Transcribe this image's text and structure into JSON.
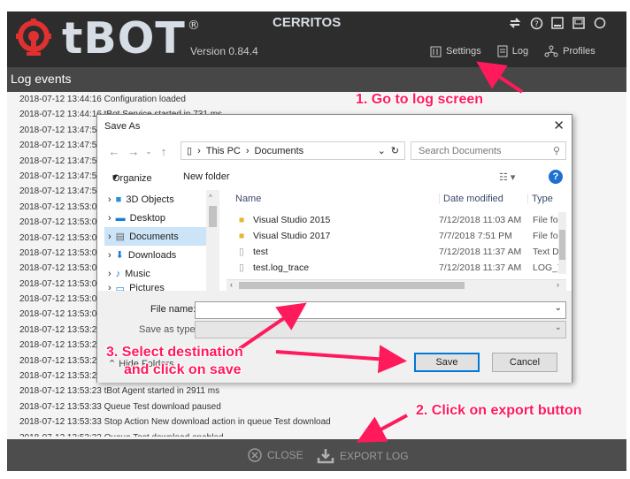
{
  "header": {
    "brand": "tBOT",
    "trademark": "®",
    "version": "Version 0.84.4",
    "device_name": "CERRITOS",
    "nav": {
      "settings": "Settings",
      "log": "Log",
      "profiles": "Profiles"
    }
  },
  "subheader": {
    "title": "Log events"
  },
  "log_lines": [
    "2018-07-12 13:44:16 Configuration loaded",
    "2018-07-12 13:44:16 tBot Service started in 731 ms",
    "2018-07-12 13:47:59",
    "2018-07-12 13:47:54",
    "2018-07-12 13:47:54",
    "2018-07-12 13:47:59",
    "2018-07-12 13:47:59",
    "2018-07-12 13:53:08",
    "2018-07-12 13:53:08",
    "2018-07-12 13:53:08",
    "2018-07-12 13:53:08",
    "2018-07-12 13:53:08",
    "2018-07-12 13:53:08",
    "2018-07-12 13:53:08",
    "2018-07-12 13:53:08",
    "2018-07-12 13:53:20",
    "2018-07-12 13:53:21",
    "2018-07-12 13:53:22",
    "2018-07-12 13:53:22",
    "2018-07-12 13:53:23 tBot Agent started in 2911 ms",
    "2018-07-12 13:53:33 Queue Test download paused",
    "2018-07-12 13:53:33 Stop Action New download action in queue Test download",
    "2018-07-12 13:53:33 Queue Test download enabled"
  ],
  "footer": {
    "close": "CLOSE",
    "export": "EXPORT LOG"
  },
  "dialog": {
    "title": "Save As",
    "path": [
      "This PC",
      "Documents"
    ],
    "search_placeholder": "Search Documents",
    "organize": "Organize",
    "new_folder": "New folder",
    "tree": [
      "3D Objects",
      "Desktop",
      "Documents",
      "Downloads",
      "Music",
      "Pictures"
    ],
    "columns": {
      "name": "Name",
      "date": "Date modified",
      "type": "Type"
    },
    "files": [
      {
        "name": "Visual Studio 2015",
        "date": "7/12/2018 11:03 AM",
        "type": "File fol"
      },
      {
        "name": "Visual Studio 2017",
        "date": "7/7/2018 7:51 PM",
        "type": "File fol"
      },
      {
        "name": "test",
        "date": "7/12/2018 11:37 AM",
        "type": "Text D"
      },
      {
        "name": "test.log_trace",
        "date": "7/12/2018 11:37 AM",
        "type": "LOG_T"
      }
    ],
    "file_name_label": "File name:",
    "file_name_value": "",
    "save_type_label": "Save as type:",
    "hide_folders": "Hide Folders",
    "save": "Save",
    "cancel": "Cancel"
  },
  "annotations": {
    "step1": "1. Go to log screen",
    "step2": "2. Click on export button",
    "step3_line1": "3. Select destination",
    "step3_line2": "and click on save"
  },
  "colors": {
    "header_bg": "#2d2d2d",
    "annotation": "#ff1a5c",
    "accent": "#0078d7"
  }
}
